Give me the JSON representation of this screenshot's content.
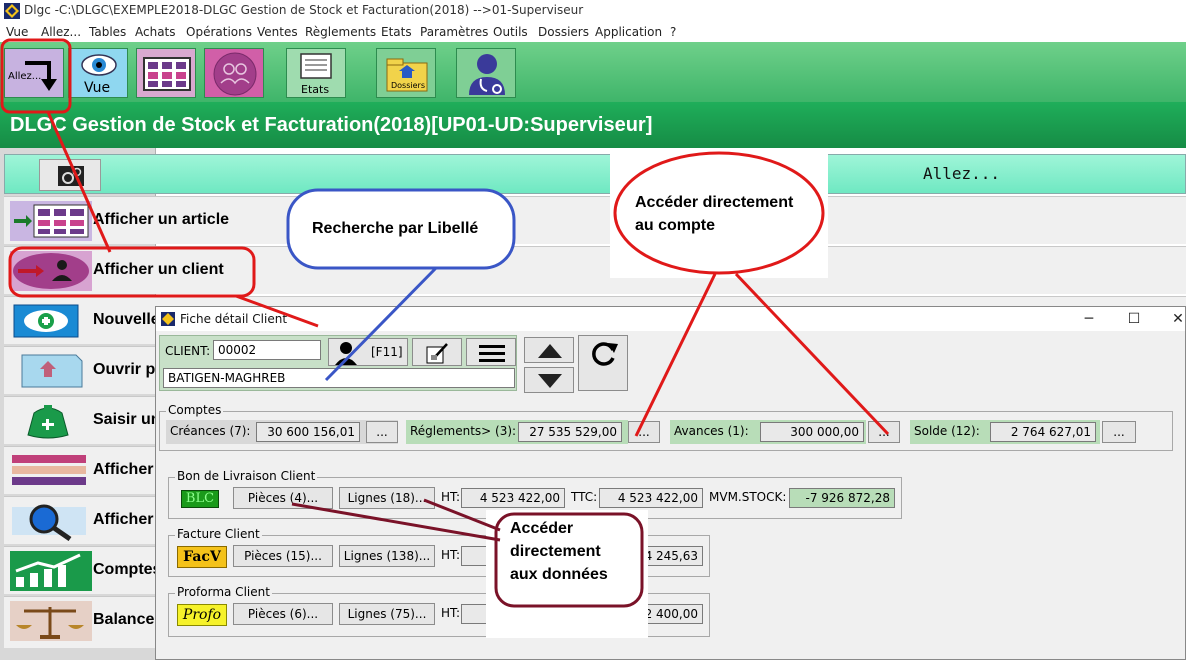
{
  "window": {
    "title": "Dlgc -C:\\DLGC\\EXEMPLE2018-DLGC Gestion de Stock et Facturation(2018) -->01-Superviseur"
  },
  "menu": [
    "Vue",
    "Allez...",
    "Tables",
    "Achats",
    "Opérations",
    "Ventes",
    "Règlements",
    "Etats",
    "Paramètres",
    "Outils",
    "Dossiers",
    "Application",
    "?"
  ],
  "toolbar": {
    "allez": "Allez...",
    "vue": "Vue",
    "etats": "Etats",
    "dossiers": "Dossiers"
  },
  "heading": "DLGC Gestion de Stock et Facturation(2018)[UP01-UD:Superviseur]",
  "allez_bar": {
    "label": "Allez..."
  },
  "left_menu": [
    "Afficher un article",
    "Afficher un client",
    "Nouvelle",
    "Ouvrir p",
    "Saisir un",
    "Afficher",
    "Afficher",
    "Comptes",
    "Balance"
  ],
  "dialog": {
    "title": "Fiche détail Client",
    "client_label": "CLIENT:",
    "client_code": "00002",
    "client_name": "BATIGEN-MAGHREB",
    "f11": "[F11]",
    "comptes": {
      "title": "Comptes",
      "creances_label": "Créances (7):",
      "creances": "30 600 156,01",
      "reglements_label": "Réglements> (3):",
      "reglements": "27 535 529,00",
      "avances_label": "Avances (1):",
      "avances": "300 000,00",
      "solde_label": "Solde (12):",
      "solde": "2 764 627,01",
      "more": "..."
    },
    "bl": {
      "title": "Bon de Livraison Client",
      "badge": "BLC",
      "pieces": "Pièces (4)...",
      "lignes": "Lignes (18)...",
      "ht_label": "HT:",
      "ht": "4 523 422,00",
      "ttc_label": "TTC:",
      "ttc": "4 523 422,00",
      "mvm_label": "MVM.STOCK:",
      "mvm": "-7 926 872,28"
    },
    "facture": {
      "title": "Facture Client",
      "badge": "FacV",
      "pieces": "Pièces (15)...",
      "lignes": "Lignes (138)...",
      "ht_label": "HT:",
      "ttc": "4 245,63"
    },
    "proforma": {
      "title": "Proforma Client",
      "badge": "Profo",
      "pieces": "Pièces (6)...",
      "lignes": "Lignes (75)...",
      "ht_label": "HT:",
      "ttc": "2 400,00"
    }
  },
  "annotations": {
    "recherche": "Recherche par Libellé",
    "compte_1": "Accéder directement",
    "compte_2": "au compte",
    "donnees_1": "Accéder",
    "donnees_2": "directement",
    "donnees_3": "aux données"
  },
  "colors": {
    "toolbar_green": "#3fb56a",
    "heading_green": "#168c45",
    "annotation_red": "#e01919",
    "annotation_blue": "#3a56c6",
    "callout_border": "#7a1228"
  }
}
